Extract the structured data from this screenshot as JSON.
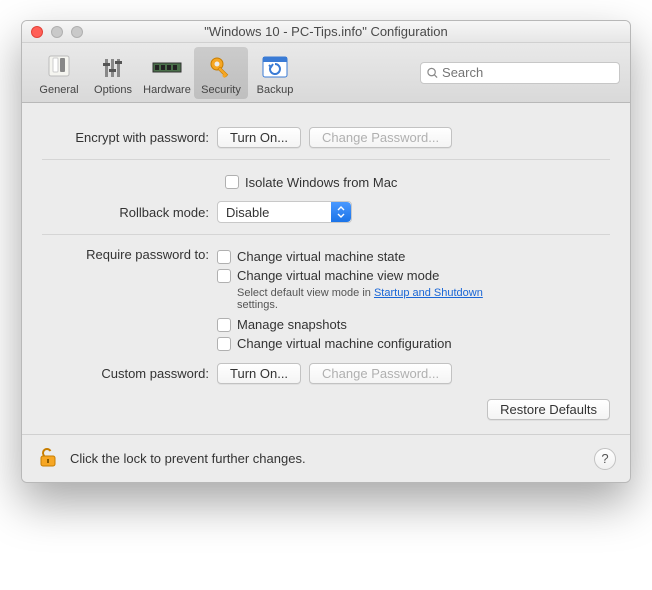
{
  "window": {
    "title": "\"Windows 10 - PC-Tips.info\" Configuration"
  },
  "toolbar": {
    "items": [
      {
        "label": "General"
      },
      {
        "label": "Options"
      },
      {
        "label": "Hardware"
      },
      {
        "label": "Security"
      },
      {
        "label": "Backup"
      }
    ],
    "search_placeholder": "Search"
  },
  "security": {
    "encrypt_label": "Encrypt with password:",
    "turn_on": "Turn On...",
    "change_password": "Change Password...",
    "isolate_label": "Isolate Windows from Mac",
    "rollback_label": "Rollback mode:",
    "rollback_value": "Disable",
    "require_label": "Require password to:",
    "req_options": [
      "Change virtual machine state",
      "Change virtual machine view mode"
    ],
    "viewmode_hint_pre": "Select default view mode in ",
    "viewmode_hint_link": "Startup and Shutdown",
    "viewmode_hint_post": " settings.",
    "req_options2": [
      "Manage snapshots",
      "Change virtual machine configuration"
    ],
    "custom_label": "Custom password:",
    "restore_defaults": "Restore Defaults"
  },
  "footer": {
    "lock_text": "Click the lock to prevent further changes.",
    "help": "?"
  }
}
